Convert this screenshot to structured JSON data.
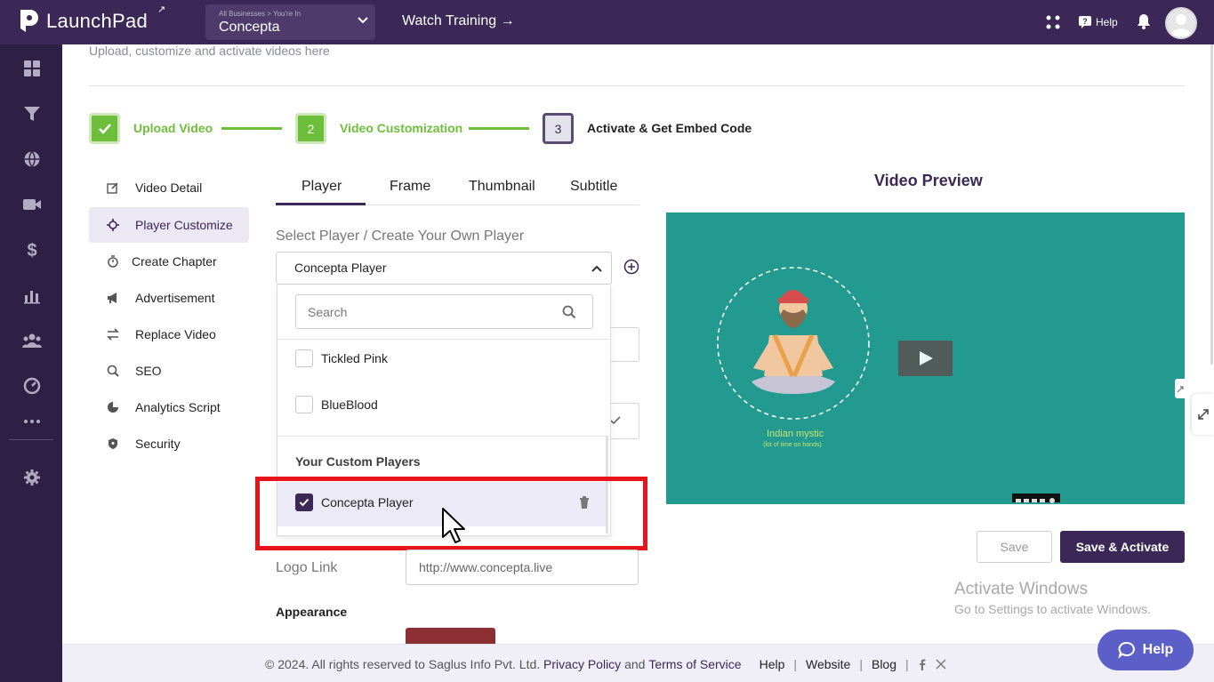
{
  "app": {
    "logo_text": "LaunchPad",
    "business_caption": "All Businesses > You're In",
    "business_name": "Concepta",
    "watch_training": "Watch Training →",
    "help_label": "Help"
  },
  "page": {
    "subtitle": "Upload, customize and activate videos here"
  },
  "steps": [
    {
      "number": "",
      "label": "Upload Video",
      "state": "done"
    },
    {
      "number": "2",
      "label": "Video Customization",
      "state": "current"
    },
    {
      "number": "3",
      "label": "Activate & Get Embed Code",
      "state": "pending"
    }
  ],
  "side_menu": [
    {
      "label": "Video Detail",
      "icon": "edit-icon"
    },
    {
      "label": "Player Customize",
      "icon": "settings-sparkle-icon",
      "active": true
    },
    {
      "label": "Create Chapter",
      "icon": "timer-icon"
    },
    {
      "label": "Advertisement",
      "icon": "megaphone-icon"
    },
    {
      "label": "Replace Video",
      "icon": "swap-icon"
    },
    {
      "label": "SEO",
      "icon": "seo-search-icon"
    },
    {
      "label": "Analytics Script",
      "icon": "pie-chart-icon"
    },
    {
      "label": "Security",
      "icon": "shield-icon"
    }
  ],
  "tabs": [
    "Player",
    "Frame",
    "Thumbnail",
    "Subtitle"
  ],
  "player_select": {
    "label": "Select Player / Create Your Own Player",
    "value": "Concepta Player",
    "search_placeholder": "Search",
    "options": [
      "Tickled Pink",
      "BlueBlood"
    ],
    "custom_group_label": "Your Custom Players",
    "custom_options": [
      {
        "label": "Concepta Player",
        "checked": true
      }
    ]
  },
  "logo_link": {
    "label": "Logo Link",
    "value": "http://www.concepta.live"
  },
  "appearance_label": "Appearance",
  "preview": {
    "title": "Video Preview",
    "caption_line1": "Indian mystic",
    "caption_line2": "(lot of time on hands)"
  },
  "buttons": {
    "save": "Save",
    "save_activate": "Save & Activate"
  },
  "windows_watermark": {
    "line1": "Activate Windows",
    "line2": "Go to Settings to activate Windows."
  },
  "footer": {
    "copyright": "©  2024. All rights reserved to Saglus Info Pvt. Ltd.",
    "privacy": "Privacy Policy",
    "and": "and",
    "terms": "Terms of Service",
    "help": "Help",
    "website": "Website",
    "blog": "Blog"
  },
  "help_fab": "Help",
  "colors": {
    "brand": "#3b2856",
    "accent_green": "#6dbf3b",
    "highlight_red": "#e8141b",
    "preview_bg": "#239a90"
  }
}
